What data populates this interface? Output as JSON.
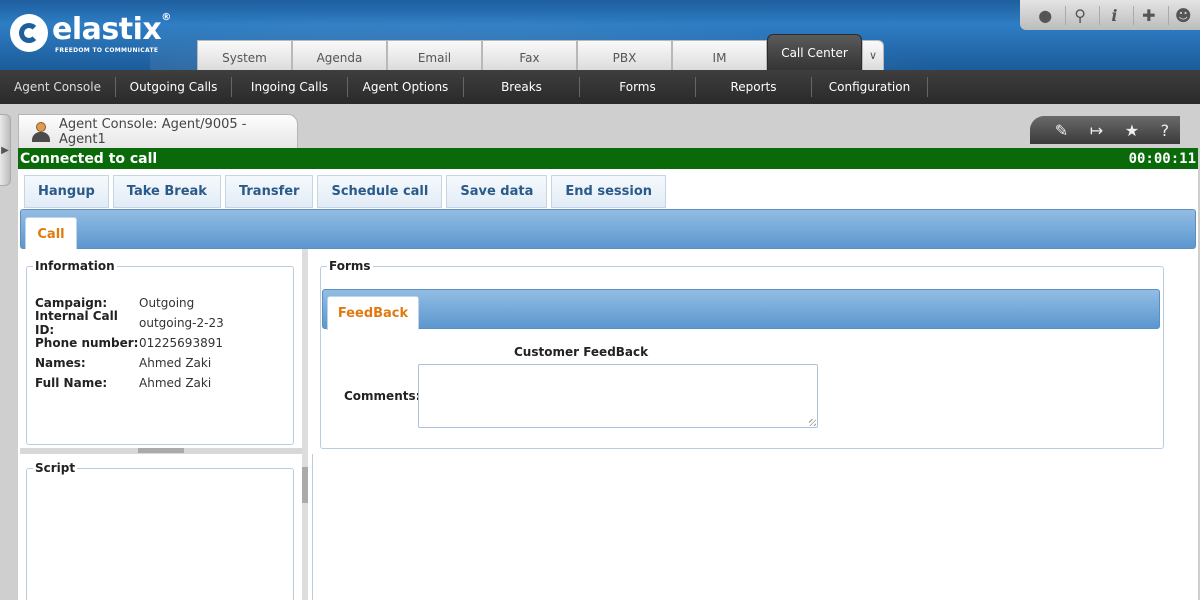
{
  "brand": {
    "name": "elastix",
    "registered": "®",
    "tagline": "FREEDOM TO COMMUNICATE"
  },
  "toolbar_icons": [
    "theme-drop-icon",
    "search-icon",
    "info-icon",
    "addons-icon",
    "user-icon"
  ],
  "top_tabs": [
    "System",
    "Agenda",
    "Email",
    "Fax",
    "PBX",
    "IM",
    "Call Center"
  ],
  "active_top_tab": "Call Center",
  "submenu": [
    "Agent Console",
    "Outgoing Calls",
    "Ingoing Calls",
    "Agent Options",
    "Breaks",
    "Forms",
    "Reports",
    "Configuration"
  ],
  "window": {
    "title": "Agent Console: Agent/9005 - Agent1"
  },
  "status": {
    "text": "Connected to call",
    "timer": "00:00:11",
    "color": "#0a6a0a"
  },
  "actions": [
    "Hangup",
    "Take Break",
    "Transfer",
    "Schedule call",
    "Save data",
    "End session"
  ],
  "call_tab": "Call",
  "information": {
    "legend": "Information",
    "rows": [
      {
        "k": "Campaign:",
        "v": "Outgoing"
      },
      {
        "k": "Internal Call ID:",
        "v": "outgoing-2-23"
      },
      {
        "k": "Phone number:",
        "v": "01225693891"
      },
      {
        "k": "Names:",
        "v": "Ahmed Zaki"
      },
      {
        "k": "Full Name:",
        "v": "Ahmed Zaki"
      }
    ]
  },
  "script": {
    "legend": "Script"
  },
  "forms": {
    "legend": "Forms",
    "tab": "FeedBack",
    "title": "Customer FeedBack",
    "comments_label": "Comments:",
    "comments_value": ""
  },
  "colors": {
    "accent_orange": "#e07a10",
    "link_blue": "#2a5a8a",
    "header_blue": "#1e5f9e"
  }
}
